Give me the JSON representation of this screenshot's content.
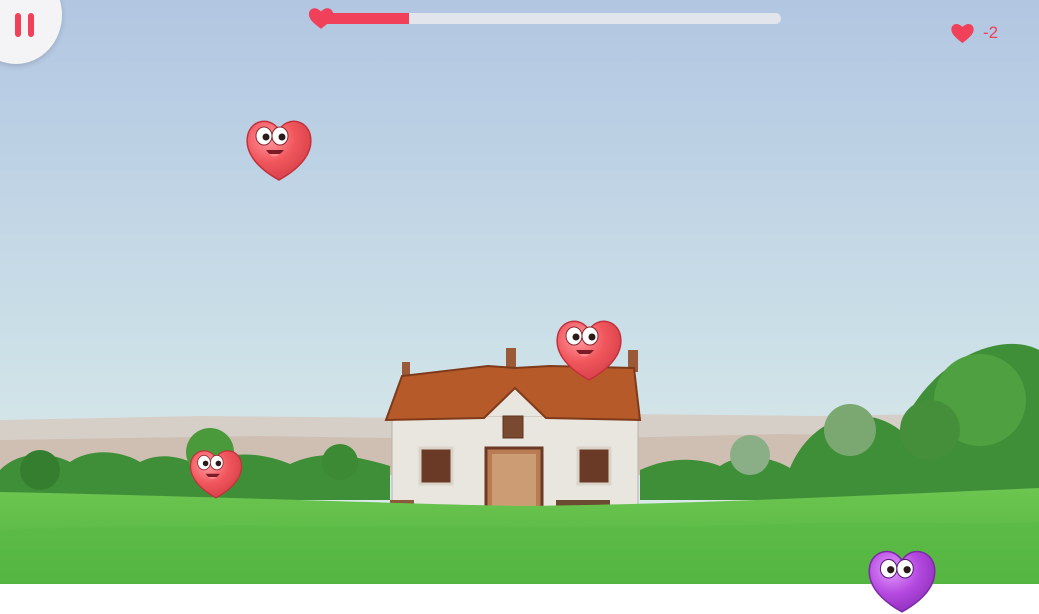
{
  "hud": {
    "pause_icon": "pause-icon",
    "progress": 0.2,
    "progress_icon": "heart-icon",
    "lives_icon": "heart-icon",
    "lives_count": "-2"
  },
  "colors": {
    "accent": "#f0405a",
    "heart_red": "#f05a5f",
    "heart_purple": "#b04ad8",
    "grass": "#5fc048",
    "sky_top": "#b2c6e2",
    "sky_bottom": "#d8ede8"
  }
}
